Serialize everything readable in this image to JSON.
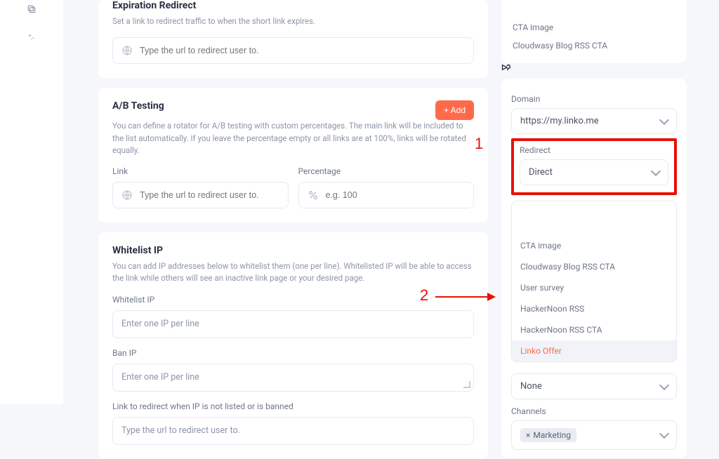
{
  "annotations": {
    "one": "1",
    "two": "2"
  },
  "expiration": {
    "title": "Expiration Redirect",
    "desc": "Set a link to redirect traffic to when the short link expires.",
    "placeholder": "Type the url to redirect user to."
  },
  "ab": {
    "title": "A/B Testing",
    "add": "+ Add",
    "desc": "You can define a rotator for A/B testing with custom percentages. The main link will be included to the list automatically. If you leave the percentage empty or all links are at 100%, links will be rotated equally.",
    "link_label": "Link",
    "pct_label": "Percentage",
    "link_placeholder": "Type the url to redirect user to.",
    "pct_placeholder": "e.g. 100"
  },
  "whitelist": {
    "title": "Whitelist IP",
    "desc": "You can add IP addresses below to whitelist them (one per line). Whitelisted IP will be able to access the link while others will see an inactive link page or your desired page.",
    "wl_label": "Whitelist IP",
    "wl_placeholder": "Enter one IP per line",
    "ban_label": "Ban IP",
    "ban_placeholder": "Enter one IP per line",
    "redir_label": "Link to redirect when IP is not listed or is banned",
    "redir_placeholder": "Type the url to redirect user to."
  },
  "right_top_items": [
    "CTA image",
    "Cloudwasy Blog RSS CTA"
  ],
  "domain": {
    "label": "Domain",
    "value": "https://my.linko.me"
  },
  "redirect": {
    "label": "Redirect",
    "value": "Direct"
  },
  "dd_items": [
    {
      "label": "CTA image",
      "active": false
    },
    {
      "label": "Cloudwasy Blog RSS CTA",
      "active": false
    },
    {
      "label": "User survey",
      "active": false
    },
    {
      "label": "HackerNoon RSS",
      "active": false
    },
    {
      "label": "HackerNoon RSS CTA",
      "active": false
    },
    {
      "label": "Linko Offer",
      "active": true
    }
  ],
  "none_select": "None",
  "channels": {
    "label": "Channels",
    "tag": "Marketing"
  }
}
